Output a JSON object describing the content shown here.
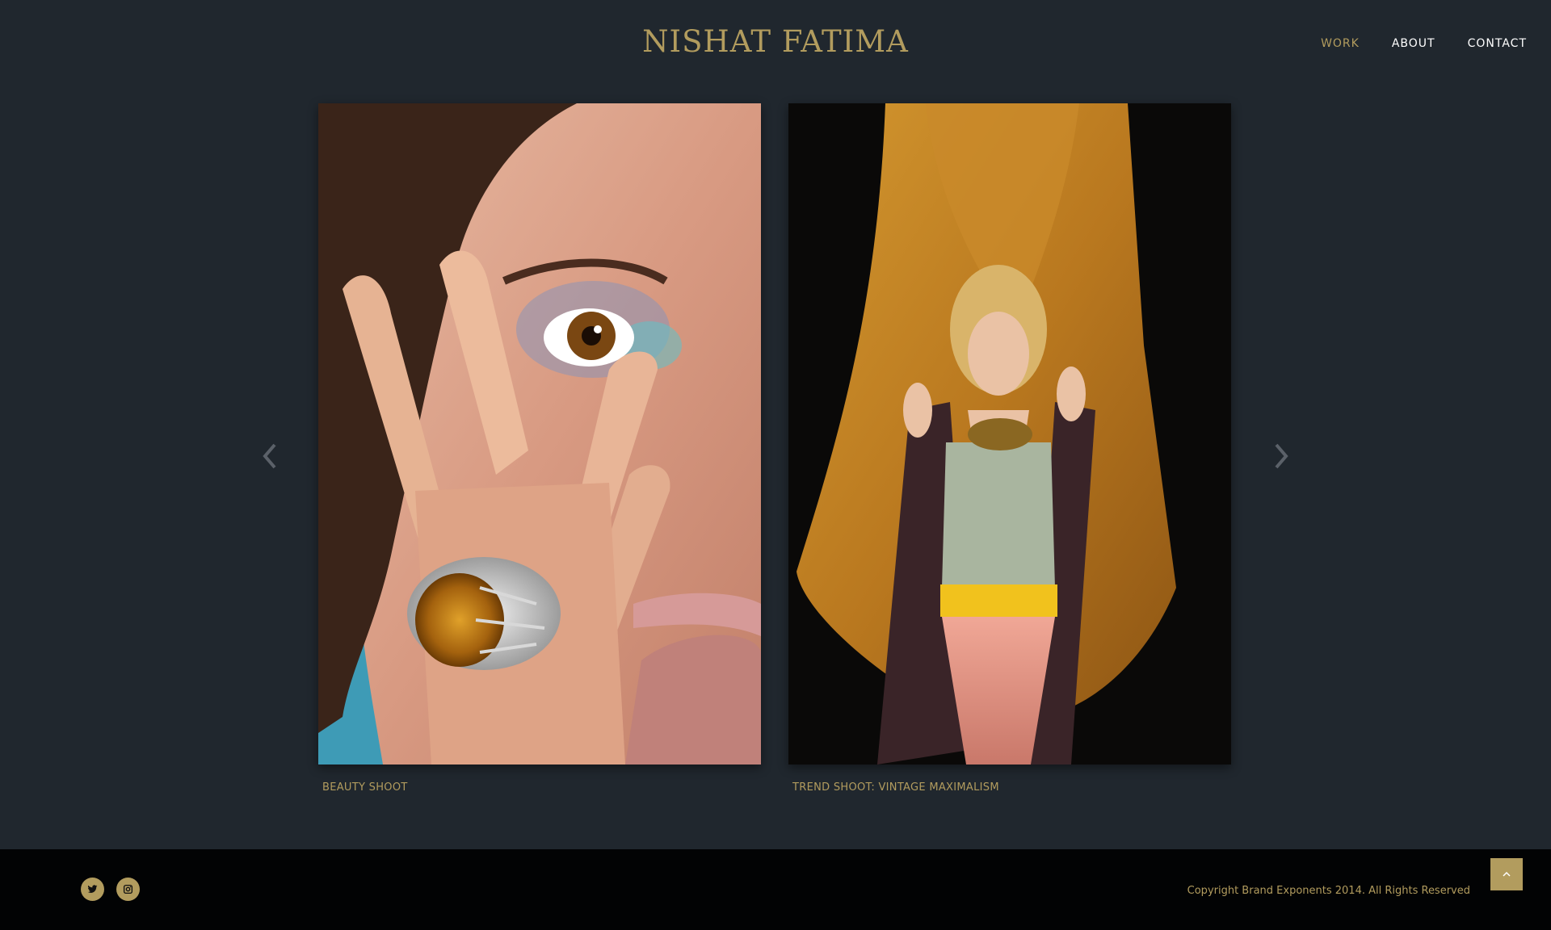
{
  "header": {
    "logo": "NISHAT FATIMA",
    "nav": [
      {
        "label": "WORK",
        "active": true
      },
      {
        "label": "ABOUT",
        "active": false
      },
      {
        "label": "CONTACT",
        "active": false
      }
    ]
  },
  "slides": [
    {
      "caption": "BEAUTY SHOOT",
      "image": "close-up portrait, hand over face with large amber ring"
    },
    {
      "caption": "TREND SHOOT: VINTAGE MAXIMALISM",
      "image": "model holding golden fabric drape"
    }
  ],
  "slider": {
    "prev_icon": "chevron-left-icon",
    "next_icon": "chevron-right-icon"
  },
  "footer": {
    "social": [
      "twitter-icon",
      "instagram-icon"
    ],
    "copyright": "Copyright Brand Exponents 2014. All Rights Reserved",
    "back_to_top_icon": "chevron-up-icon"
  },
  "colors": {
    "background": "#20272e",
    "accent": "#b29c5e",
    "footer": "#020304",
    "nav_text": "#ffffff"
  }
}
